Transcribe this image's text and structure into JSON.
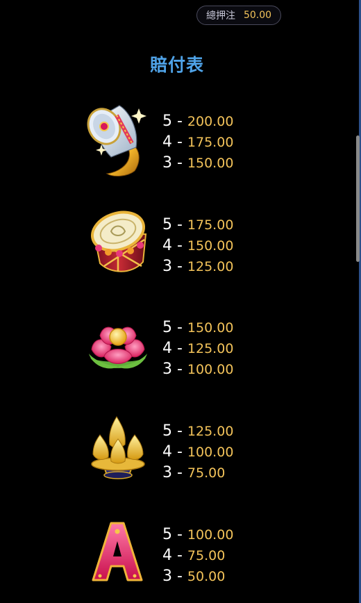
{
  "header": {
    "bet_label": "總押注",
    "bet_value": "50.00"
  },
  "title": "賠付表",
  "symbols": [
    {
      "icon": "horn-icon",
      "pays": [
        {
          "count": "5 - ",
          "value": "200.00"
        },
        {
          "count": "4 - ",
          "value": "175.00"
        },
        {
          "count": "3 - ",
          "value": "150.00"
        }
      ]
    },
    {
      "icon": "drum-icon",
      "pays": [
        {
          "count": "5 - ",
          "value": "175.00"
        },
        {
          "count": "4 - ",
          "value": "150.00"
        },
        {
          "count": "3 - ",
          "value": "125.00"
        }
      ]
    },
    {
      "icon": "lotus-icon",
      "pays": [
        {
          "count": "5 - ",
          "value": "150.00"
        },
        {
          "count": "4 - ",
          "value": "125.00"
        },
        {
          "count": "3 - ",
          "value": "100.00"
        }
      ]
    },
    {
      "icon": "sweets-bowl-icon",
      "pays": [
        {
          "count": "5 - ",
          "value": "125.00"
        },
        {
          "count": "4 - ",
          "value": "100.00"
        },
        {
          "count": "3 - ",
          "value": "75.00"
        }
      ]
    },
    {
      "icon": "letter-a-icon",
      "pays": [
        {
          "count": "5 - ",
          "value": "100.00"
        },
        {
          "count": "4 - ",
          "value": "75.00"
        },
        {
          "count": "3 - ",
          "value": "50.00"
        }
      ]
    }
  ],
  "colors": {
    "title": "#4fa3e8",
    "payout_value": "#f3c35a",
    "count": "#ffffff",
    "background": "#000000"
  }
}
